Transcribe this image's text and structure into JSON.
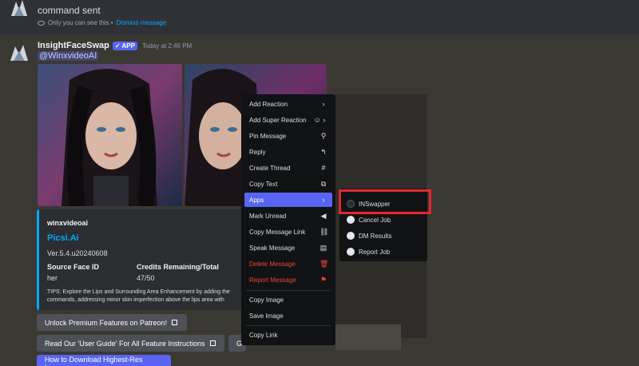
{
  "top_message": {
    "text": "command sent",
    "ephemeral_note": "Only you can see this •",
    "dismiss_link": "Dismiss message"
  },
  "message": {
    "username": "InsightFaceSwap",
    "app_badge": "✓ APP",
    "timestamp": "Today at 2:46 PM",
    "mention": "@WinxvideoAI"
  },
  "embed": {
    "author": "winxvideoai",
    "title": "Picsi.Ai",
    "version": "Ver.5.4.u20240608",
    "fields": [
      {
        "name": "Source Face ID",
        "value": "her"
      },
      {
        "name": "Credits Remaining/Total",
        "value": "47/50"
      }
    ],
    "tips_line1": "TIPS: Explore the Lips and Surrounding Area Enhancement by adding the",
    "tips_line2": "commands, addressing minor skin imperfection above the lips area with",
    "accent_color": "#00a8fc"
  },
  "buttons": {
    "patreon": "Unlock Premium Features on Patreon!",
    "guide": "Read Our 'User Guide' For All Feature Instructions",
    "g": "G",
    "download": "How to Download Highest-Res Image"
  },
  "context_menu": {
    "items": [
      {
        "label": "Add Reaction",
        "icon": "›"
      },
      {
        "label": "Add Super Reaction",
        "icon": "☺ ›"
      },
      {
        "label": "Pin Message",
        "icon": "⚲"
      },
      {
        "label": "Reply",
        "icon": "↰"
      },
      {
        "label": "Create Thread",
        "icon": "#"
      },
      {
        "label": "Copy Text",
        "icon": "⧉"
      },
      {
        "label": "Apps",
        "icon": "›"
      },
      {
        "label": "Mark Unread",
        "icon": "◀"
      },
      {
        "label": "Copy Message Link",
        "icon": "⛓"
      },
      {
        "label": "Speak Message",
        "icon": "▤"
      },
      {
        "label": "Delete Message",
        "icon": "🗑"
      },
      {
        "label": "Report Message",
        "icon": "⚑"
      },
      {
        "label": "Copy Image",
        "icon": ""
      },
      {
        "label": "Save Image",
        "icon": ""
      },
      {
        "label": "Copy Link",
        "icon": ""
      }
    ],
    "danger_color": "#f23f42",
    "active_color": "#5865f2"
  },
  "apps_submenu": {
    "items": [
      {
        "label": "INSwapper"
      },
      {
        "label": "Cancel Job"
      },
      {
        "label": "DM Results"
      },
      {
        "label": "Report Job"
      }
    ],
    "highlight_color": "#e4262f"
  }
}
